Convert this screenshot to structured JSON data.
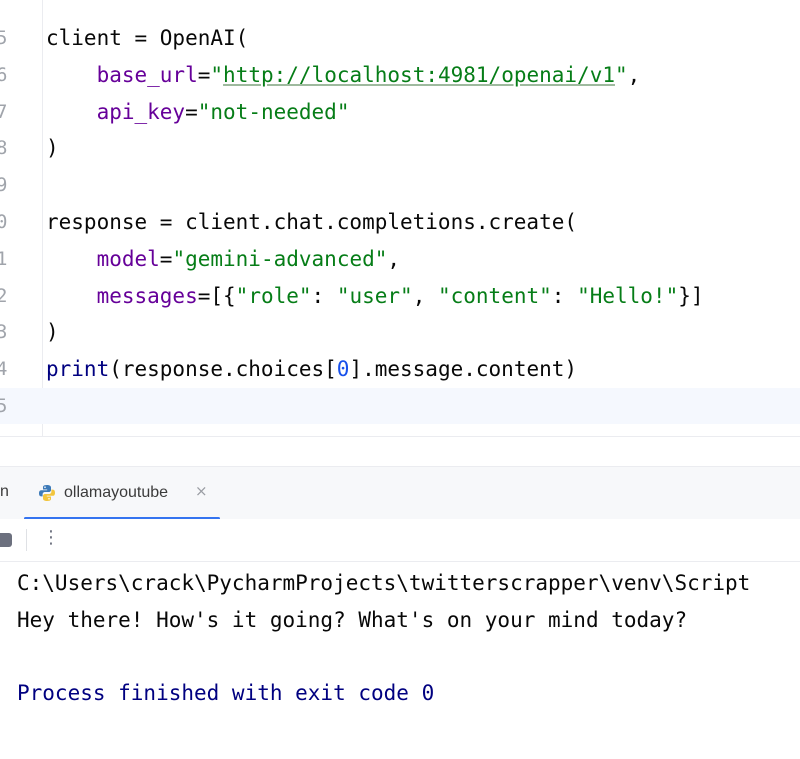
{
  "editor": {
    "lines": [
      {
        "num": "5",
        "tokens": [
          {
            "t": "client = OpenAI(",
            "c": ""
          }
        ]
      },
      {
        "num": "6",
        "tokens": [
          {
            "t": "    ",
            "c": ""
          },
          {
            "t": "base_url",
            "c": "param"
          },
          {
            "t": "=",
            "c": ""
          },
          {
            "t": "\"",
            "c": "str"
          },
          {
            "t": "http://localhost:4981/openai/v1",
            "c": "url"
          },
          {
            "t": "\"",
            "c": "str"
          },
          {
            "t": ",",
            "c": ""
          }
        ]
      },
      {
        "num": "7",
        "tokens": [
          {
            "t": "    ",
            "c": ""
          },
          {
            "t": "api_key",
            "c": "param"
          },
          {
            "t": "=",
            "c": ""
          },
          {
            "t": "\"not-needed\"",
            "c": "str"
          }
        ]
      },
      {
        "num": "8",
        "tokens": [
          {
            "t": ")",
            "c": ""
          }
        ]
      },
      {
        "num": "9",
        "tokens": []
      },
      {
        "num": "0",
        "tokens": [
          {
            "t": "response = client.chat.completions.create(",
            "c": ""
          }
        ]
      },
      {
        "num": "1",
        "tokens": [
          {
            "t": "    ",
            "c": ""
          },
          {
            "t": "model",
            "c": "param"
          },
          {
            "t": "=",
            "c": ""
          },
          {
            "t": "\"gemini-advanced\"",
            "c": "str"
          },
          {
            "t": ",",
            "c": ""
          }
        ]
      },
      {
        "num": "2",
        "tokens": [
          {
            "t": "    ",
            "c": ""
          },
          {
            "t": "messages",
            "c": "param"
          },
          {
            "t": "=[{",
            "c": ""
          },
          {
            "t": "\"role\"",
            "c": "str"
          },
          {
            "t": ": ",
            "c": ""
          },
          {
            "t": "\"user\"",
            "c": "str"
          },
          {
            "t": ", ",
            "c": ""
          },
          {
            "t": "\"content\"",
            "c": "str"
          },
          {
            "t": ": ",
            "c": ""
          },
          {
            "t": "\"Hello!\"",
            "c": "str"
          },
          {
            "t": "}]",
            "c": ""
          }
        ]
      },
      {
        "num": "3",
        "tokens": [
          {
            "t": ")",
            "c": ""
          }
        ]
      },
      {
        "num": "4",
        "tokens": [
          {
            "t": "print",
            "c": "kw"
          },
          {
            "t": "(response.choices[",
            "c": ""
          },
          {
            "t": "0",
            "c": "num"
          },
          {
            "t": "].message.content)",
            "c": ""
          }
        ]
      },
      {
        "num": "5",
        "tokens": []
      }
    ]
  },
  "run_panel": {
    "partial_tab_label": "n",
    "tab": {
      "label": "ollamayoutube",
      "icon": "python-icon",
      "close_glyph": "×"
    },
    "more_glyph": "⋮"
  },
  "console": {
    "lines": [
      "C:\\Users\\crack\\PycharmProjects\\twitterscrapper\\venv\\Script",
      "Hey there! How's it going? What's on your mind today?",
      "",
      "Process finished with exit code 0"
    ]
  },
  "colors": {
    "accent": "#3574f0",
    "string": "#067d17",
    "keyword": "#000080",
    "parameter": "#660099",
    "number": "#1750eb"
  }
}
